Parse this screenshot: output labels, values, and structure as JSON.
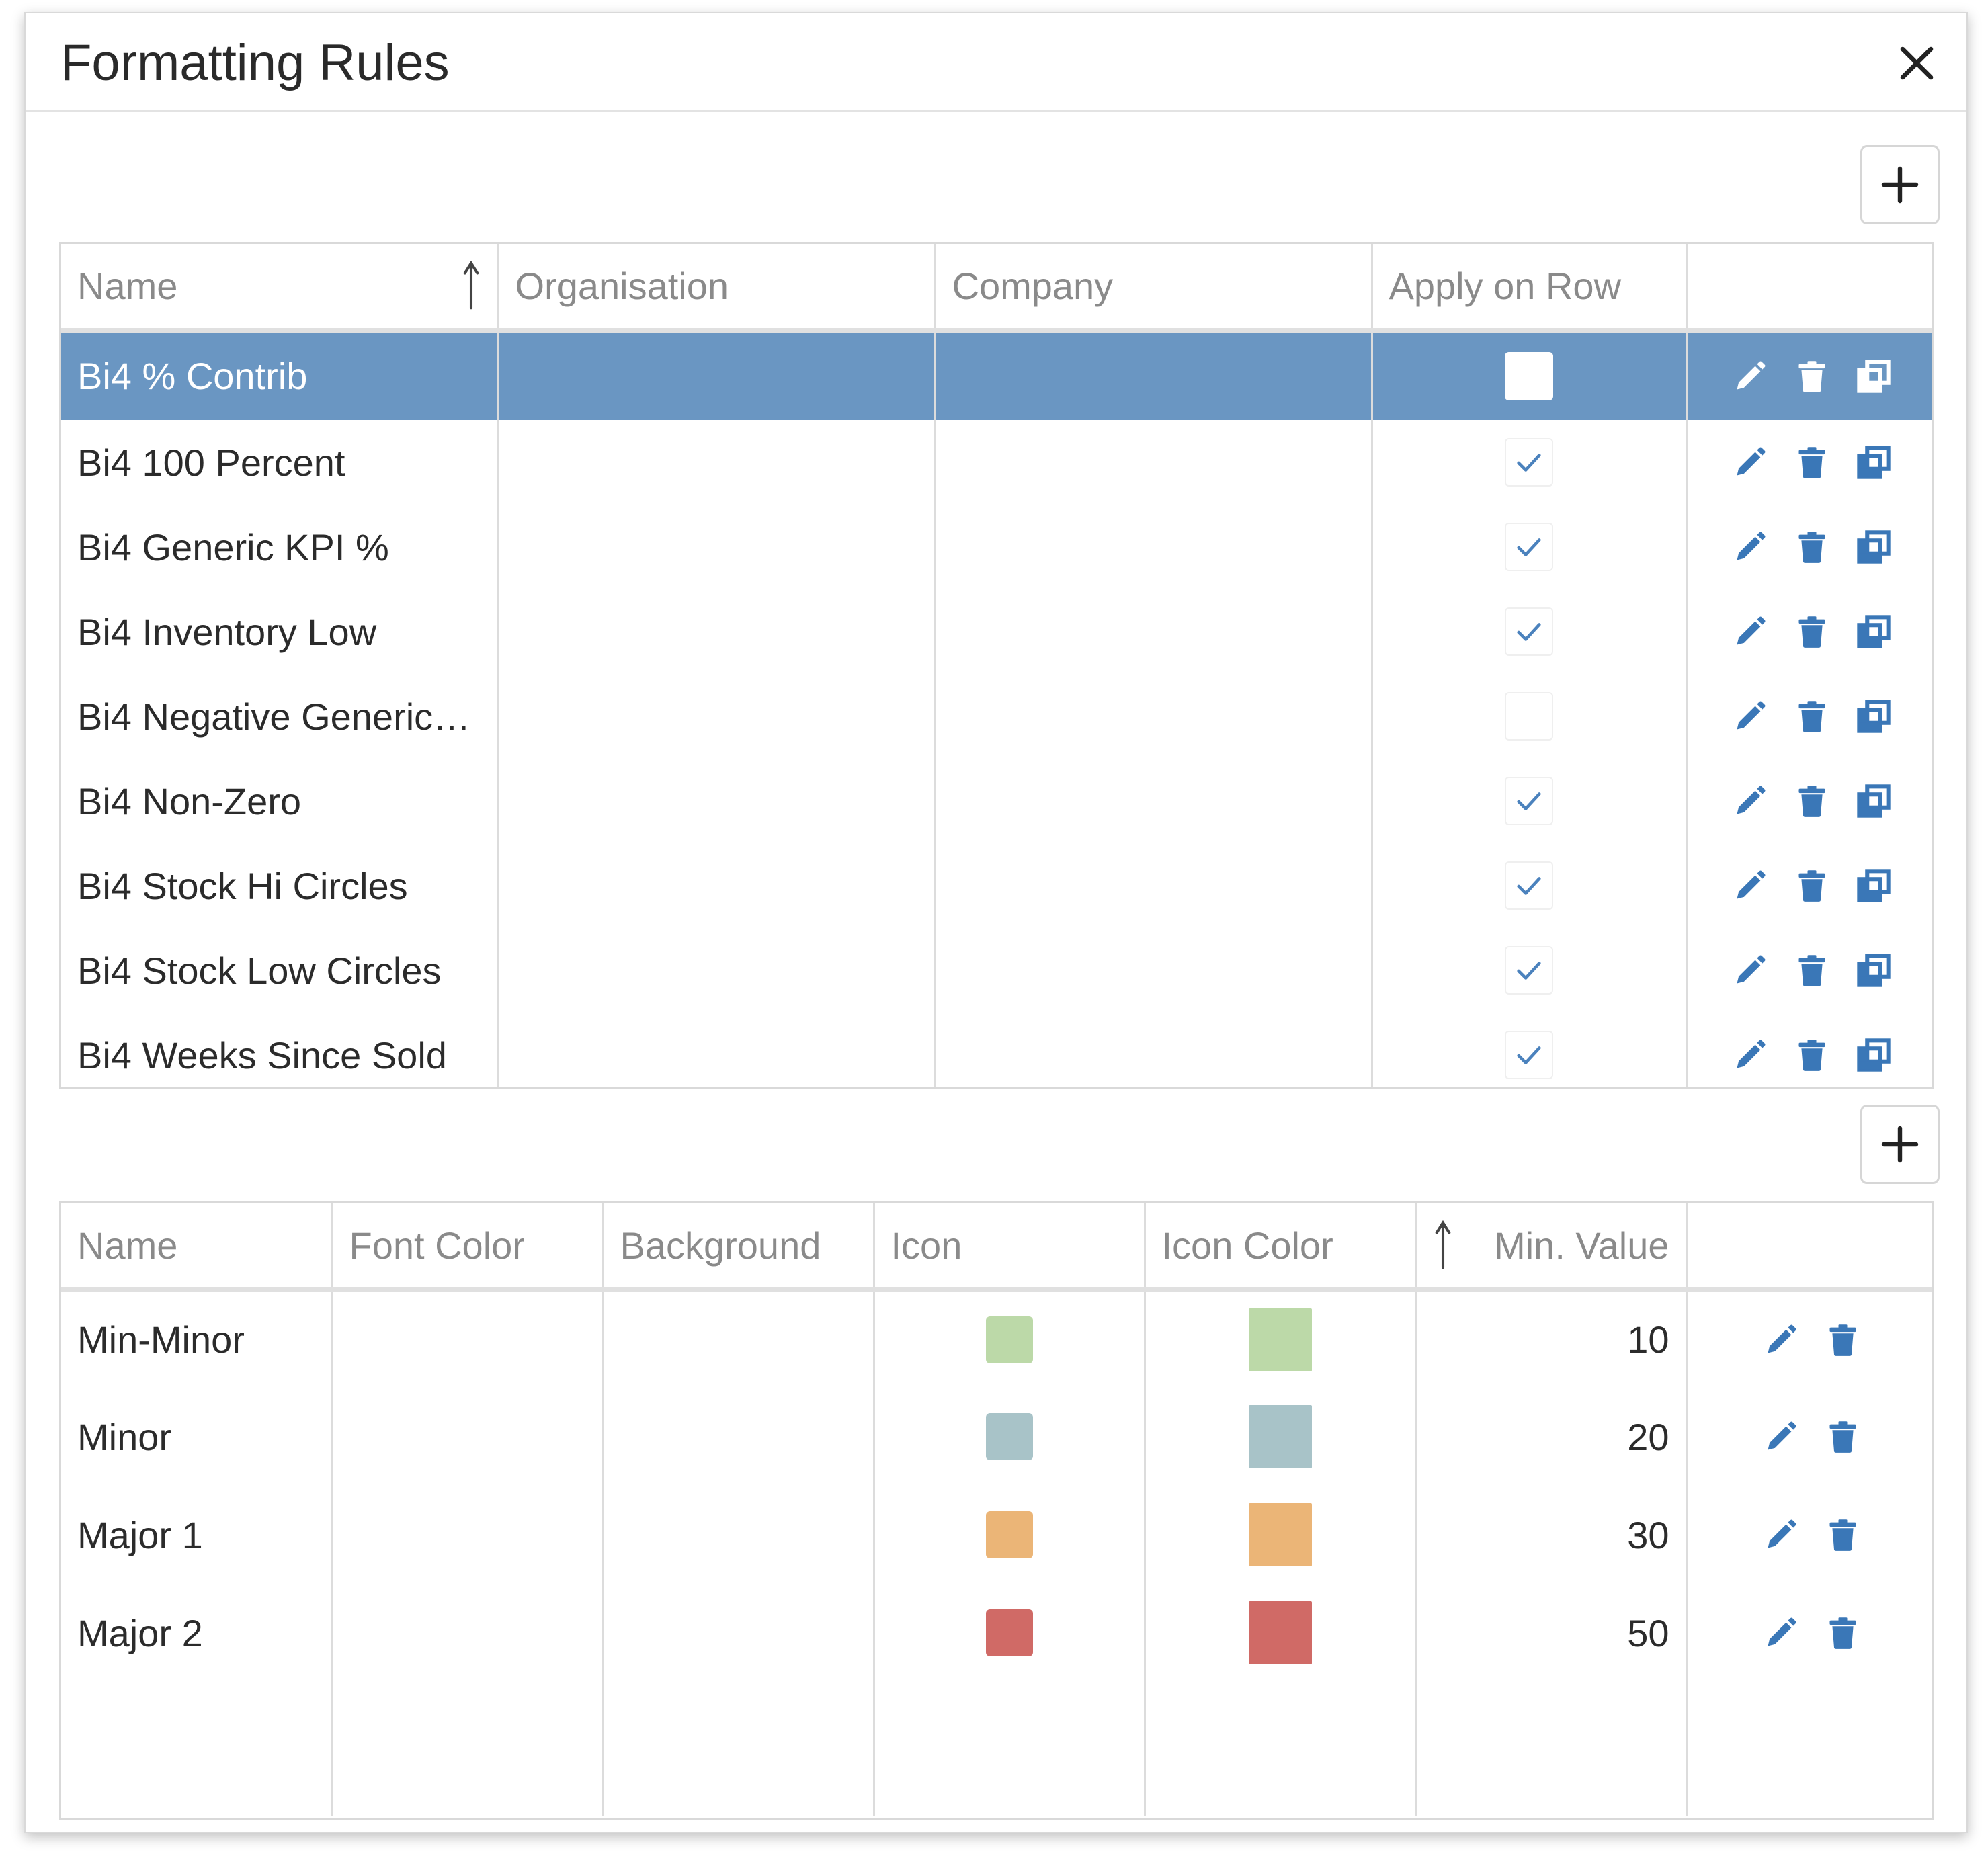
{
  "dialog": {
    "title": "Formatting Rules",
    "close_icon": "close-icon"
  },
  "rules": {
    "add_icon": "plus-icon",
    "columns": {
      "name": "Name",
      "organisation": "Organisation",
      "company": "Company",
      "apply_on_row": "Apply on Row"
    },
    "sorted_by": "name",
    "rows": [
      {
        "name": "Bi4 % Contrib",
        "organisation": "",
        "company": "",
        "apply_on_row": false,
        "selected": true
      },
      {
        "name": "Bi4 100 Percent",
        "organisation": "",
        "company": "",
        "apply_on_row": true,
        "selected": false
      },
      {
        "name": "Bi4 Generic KPI %",
        "organisation": "",
        "company": "",
        "apply_on_row": true,
        "selected": false
      },
      {
        "name": "Bi4 Inventory Low",
        "organisation": "",
        "company": "",
        "apply_on_row": true,
        "selected": false
      },
      {
        "name": "Bi4 Negative Generic…",
        "organisation": "",
        "company": "",
        "apply_on_row": false,
        "selected": false
      },
      {
        "name": "Bi4 Non-Zero",
        "organisation": "",
        "company": "",
        "apply_on_row": true,
        "selected": false
      },
      {
        "name": "Bi4 Stock Hi Circles",
        "organisation": "",
        "company": "",
        "apply_on_row": true,
        "selected": false
      },
      {
        "name": "Bi4 Stock Low Circles",
        "organisation": "",
        "company": "",
        "apply_on_row": true,
        "selected": false
      },
      {
        "name": "Bi4 Weeks Since Sold",
        "organisation": "",
        "company": "",
        "apply_on_row": true,
        "selected": false
      }
    ]
  },
  "levels": {
    "add_icon": "plus-icon",
    "columns": {
      "name": "Name",
      "font_color": "Font Color",
      "background": "Background",
      "icon": "Icon",
      "icon_color": "Icon Color",
      "min_value": "Min. Value"
    },
    "sorted_by": "min_value",
    "rows": [
      {
        "name": "Min-Minor",
        "font_color": "",
        "background": "",
        "icon_color_hex": "#bcd9a8",
        "swatch_color": "#bcd9a8",
        "min_value": "10"
      },
      {
        "name": "Minor",
        "font_color": "",
        "background": "",
        "icon_color_hex": "#a8c3c8",
        "swatch_color": "#a8c3c8",
        "min_value": "20"
      },
      {
        "name": "Major 1",
        "font_color": "",
        "background": "",
        "icon_color_hex": "#ebb577",
        "swatch_color": "#ebb577",
        "min_value": "30"
      },
      {
        "name": "Major 2",
        "font_color": "",
        "background": "",
        "icon_color_hex": "#d06a66",
        "swatch_color": "#d06a66",
        "min_value": "50"
      }
    ]
  },
  "colors": {
    "accent": "#3a77b7",
    "selected_row": "#6a96c2",
    "check": "#4b82bd"
  },
  "row_icons": [
    "edit-icon",
    "delete-icon",
    "copy-icon"
  ]
}
